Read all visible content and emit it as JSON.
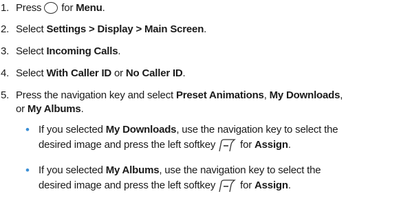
{
  "steps": [
    {
      "num": "1.",
      "pre": "Press",
      "mid": "for",
      "bold": "Menu",
      "post": "."
    },
    {
      "num": "2.",
      "pre": "Select",
      "bold": "Settings > Display > Main Screen",
      "post": "."
    },
    {
      "num": "3.",
      "pre": "Select",
      "bold": "Incoming Calls",
      "post": "."
    },
    {
      "num": "4.",
      "pre": "Select",
      "bold1": "With Caller ID",
      "mid": "or",
      "bold2": "No Caller ID",
      "post": "."
    },
    {
      "num": "5.",
      "line1_pre": "Press the navigation key and select",
      "bold1": "Preset Animations",
      "sep": ",",
      "bold2": "My Downloads",
      "sep2": ",",
      "line2_pre": "or",
      "bold3": "My Albums",
      "post": "."
    }
  ],
  "bullets": [
    {
      "pre": "If you selected",
      "bold": "My Downloads",
      "line1_post": ", use the navigation key to select the",
      "line2_pre": "desired image and press the left softkey",
      "for": "for",
      "assign": "Assign",
      "post": "."
    },
    {
      "pre": "If you selected",
      "bold": "My Albums",
      "line1_post": ", use the navigation key to select the",
      "line2_pre": "desired image and press the left softkey",
      "for": "for",
      "assign": "Assign",
      "post": "."
    }
  ],
  "icons": {
    "menu_key": "circle-key-icon",
    "softkey": "left-softkey-icon"
  },
  "colors": {
    "bullet": "#3a8fd6",
    "text": "#1a1a1a"
  }
}
